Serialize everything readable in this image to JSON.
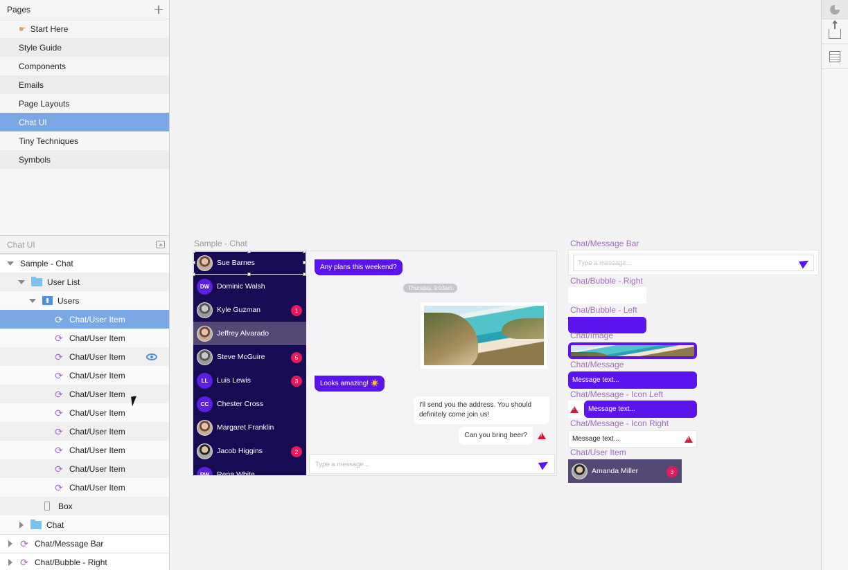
{
  "pages": {
    "title": "Pages",
    "items": [
      {
        "label": "Start Here",
        "icon": "hand-pointer-icon"
      },
      {
        "label": "Style Guide"
      },
      {
        "label": "Components"
      },
      {
        "label": "Emails"
      },
      {
        "label": "Page Layouts"
      },
      {
        "label": "Chat UI",
        "selected": true
      },
      {
        "label": "Tiny Techniques"
      },
      {
        "label": "Symbols"
      }
    ]
  },
  "layers": {
    "title": "Chat UI",
    "items": [
      {
        "label": "Sample - Chat",
        "kind": "artboard"
      },
      {
        "label": "User List",
        "kind": "folder"
      },
      {
        "label": "Users",
        "kind": "group"
      },
      {
        "label": "Chat/User Item",
        "kind": "symbol",
        "selected": true
      },
      {
        "label": "Chat/User Item",
        "kind": "symbol"
      },
      {
        "label": "Chat/User Item",
        "kind": "symbol",
        "eye": true
      },
      {
        "label": "Chat/User Item",
        "kind": "symbol"
      },
      {
        "label": "Chat/User Item",
        "kind": "symbol"
      },
      {
        "label": "Chat/User Item",
        "kind": "symbol"
      },
      {
        "label": "Chat/User Item",
        "kind": "symbol"
      },
      {
        "label": "Chat/User Item",
        "kind": "symbol"
      },
      {
        "label": "Chat/User Item",
        "kind": "symbol"
      },
      {
        "label": "Chat/User Item",
        "kind": "symbol"
      },
      {
        "label": "Box",
        "kind": "box"
      },
      {
        "label": "Chat",
        "kind": "folder-collapsed"
      },
      {
        "label": "Chat/Message Bar",
        "kind": "symbol-collapsed"
      },
      {
        "label": "Chat/Bubble - Right",
        "kind": "symbol-collapsed"
      }
    ]
  },
  "canvas": {
    "artboard_title": "Sample - Chat",
    "users": [
      {
        "name": "Sue Barnes",
        "avatar": "photo"
      },
      {
        "name": "Dominic Walsh",
        "initials": "DW"
      },
      {
        "name": "Kyle Guzman",
        "avatar": "photo",
        "badge": "1"
      },
      {
        "name": "Jeffrey Alvarado",
        "avatar": "photo",
        "highlight": true
      },
      {
        "name": "Steve McGuire",
        "avatar": "photo",
        "badge": "5"
      },
      {
        "name": "Luis Lewis",
        "initials": "LL",
        "badge": "3"
      },
      {
        "name": "Chester Cross",
        "initials": "CC"
      },
      {
        "name": "Margaret Franklin",
        "avatar": "photo"
      },
      {
        "name": "Jacob Higgins",
        "avatar": "photo",
        "badge": "2"
      },
      {
        "name": "Rena White",
        "initials": "RW"
      }
    ],
    "messages": {
      "m1": "Any plans this weekend?",
      "date": "Thursday, 9:03am",
      "m2": "Looks amazing! ☀️",
      "m3": "I'll send you the address. You should definitely come join us!",
      "m4": "Can you bring beer?",
      "placeholder": "Type a message..."
    },
    "symbols": {
      "message_bar": "Chat/Message Bar",
      "message_bar_placeholder": "Type a message...",
      "bubble_right": "Chat/Bubble - Right",
      "bubble_left": "Chat/Bubble - Left",
      "image": "Chat/Image",
      "message": "Chat/Message",
      "message_text": "Message text...",
      "icon_left": "Chat/Message - Icon Left",
      "icon_left_text": "Message text...",
      "icon_right": "Chat/Message - Icon Right",
      "icon_right_text": "Message text...",
      "user_item": "Chat/User Item",
      "user_item_name": "Amanda Miller",
      "user_item_badge": "3"
    }
  },
  "colors": {
    "accent": "#5b14ee",
    "sidebar_dark": "#170c54",
    "badge": "#e8195a",
    "selection": "#7aa7e6"
  }
}
